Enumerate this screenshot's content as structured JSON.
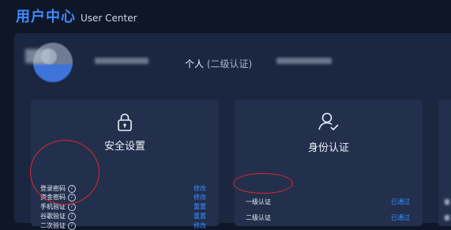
{
  "header": {
    "title_cn": "用户中心",
    "title_en": "User Center"
  },
  "user": {
    "type_label": "个人",
    "type_sub": "(二级认证)"
  },
  "security_card": {
    "title": "安全设置",
    "rows": [
      {
        "label": "登录密码",
        "action": "修改"
      },
      {
        "label": "资金密码",
        "action": "修改"
      },
      {
        "label": "手机验证",
        "action": "重置"
      },
      {
        "label": "谷歌验证",
        "action": "重置"
      },
      {
        "label": "二次验证",
        "action": "修改"
      }
    ]
  },
  "identity_card": {
    "title": "身份认证",
    "rows": [
      {
        "label": "一级认证",
        "status": "已通过"
      },
      {
        "label": "二级认证",
        "status": "已通过"
      }
    ]
  },
  "colors": {
    "accent": "#3f8bff",
    "annotation": "#e0262b",
    "background": "#0f1628",
    "panel": "#1b2741",
    "card": "#22304d"
  }
}
